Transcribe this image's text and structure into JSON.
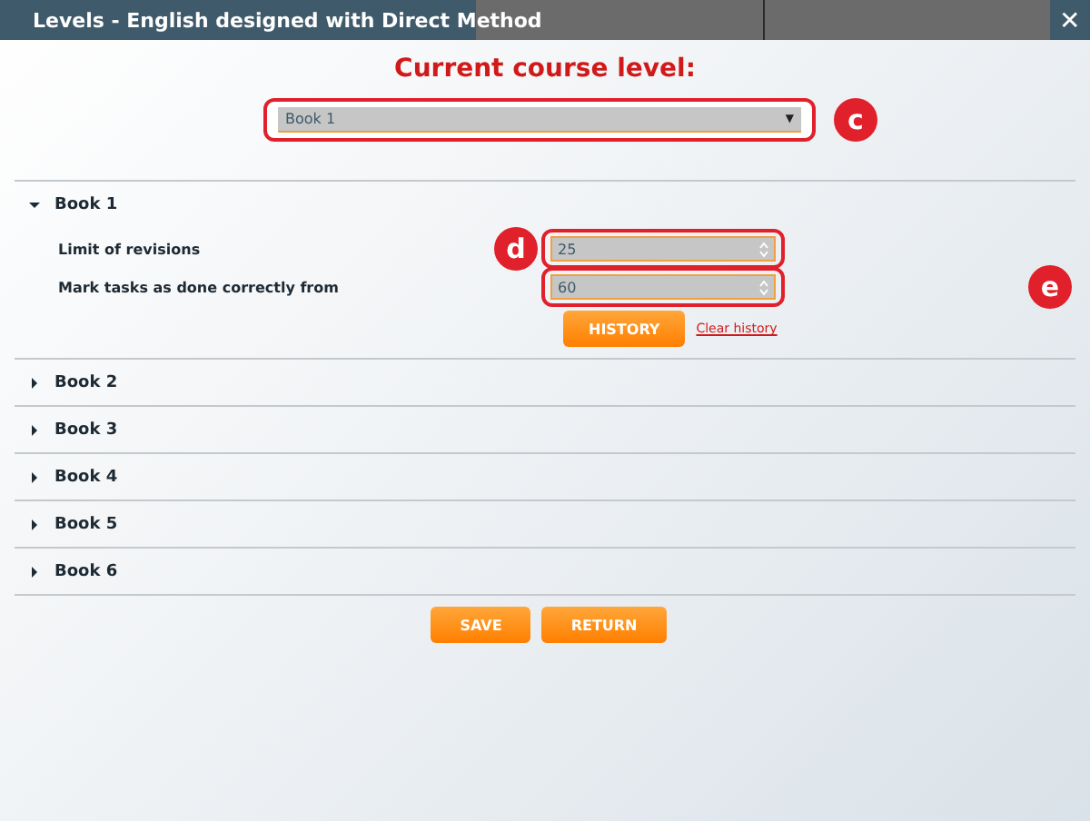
{
  "window": {
    "title": "Levels - English designed with Direct Method",
    "close": "✕"
  },
  "heading": "Current course level:",
  "course_select": {
    "value": "Book 1",
    "caret": "▼",
    "callout": "c"
  },
  "books": [
    {
      "label": "Book 1",
      "expanded": true,
      "settings": [
        {
          "label": "Limit of revisions",
          "value": "25",
          "callout": "d"
        },
        {
          "label": "Mark tasks as done correctly from",
          "value": "60",
          "callout": "e"
        }
      ],
      "history_button": "HISTORY",
      "clear_link": "Clear history"
    },
    {
      "label": "Book 2",
      "expanded": false
    },
    {
      "label": "Book 3",
      "expanded": false
    },
    {
      "label": "Book 4",
      "expanded": false
    },
    {
      "label": "Book 5",
      "expanded": false
    },
    {
      "label": "Book 6",
      "expanded": false
    }
  ],
  "buttons": [
    "SAVE",
    "RETURN"
  ]
}
